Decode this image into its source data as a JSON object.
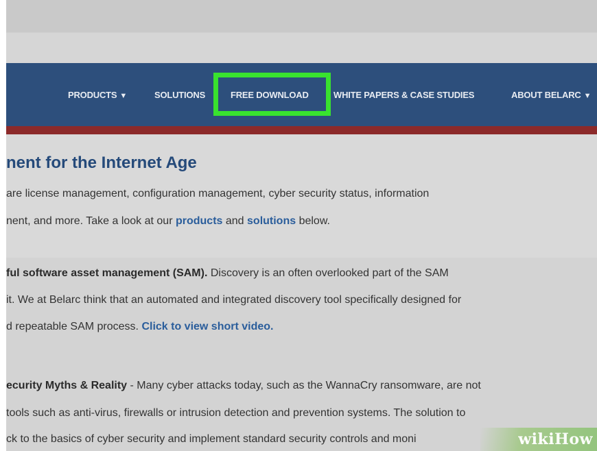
{
  "nav": {
    "items": [
      {
        "label": "PRODUCTS",
        "arrow": "▼"
      },
      {
        "label": "SOLUTIONS"
      },
      {
        "label": "FREE DOWNLOAD"
      },
      {
        "label": "WHITE PAPERS & CASE STUDIES"
      },
      {
        "label": "ABOUT BELARC",
        "arrow": "▼"
      }
    ]
  },
  "content": {
    "heading": "nent for the Internet Age",
    "para1": {
      "line1": "are license management, configuration management, cyber security status, information",
      "line2_pre": "nent, and more.  Take a look at our ",
      "link_products": "products",
      "line2_mid": " and ",
      "link_solutions": "solutions",
      "line2_post": " below."
    },
    "para2": {
      "bold": "ful software asset management (SAM).",
      "line1_rest": " Discovery is an often overlooked part of the SAM",
      "line2": "it. We at Belarc think that an automated and integrated discovery tool specifically designed for",
      "line3_pre": "d repeatable SAM process. ",
      "video_link": "Click to view short video."
    },
    "para3": {
      "bold": "ecurity Myths & Reality",
      "line1_rest": " - Many cyber attacks today, such as the WannaCry ransomware, are not",
      "line2": " tools such as anti-virus, firewalls or intrusion detection and prevention systems. The solution to",
      "line3": "ck to the basics of cyber security and implement standard security controls and moni"
    }
  },
  "watermark": {
    "part1": "wiki",
    "part2": "How"
  },
  "colors": {
    "navbar": "#2d4f7c",
    "highlight": "#39e22f",
    "redbar": "#8c2a2a",
    "heading": "#254a7a",
    "link": "#2a5d9b"
  }
}
